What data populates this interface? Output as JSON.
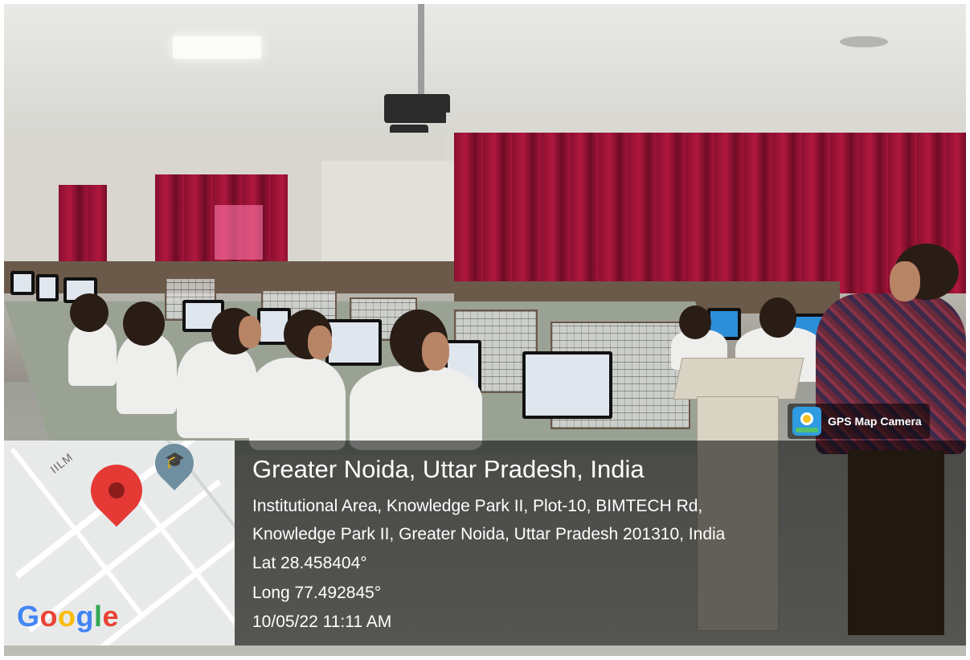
{
  "overlay": {
    "brand": {
      "label": "GPS Map Camera",
      "icon": "gps-map-camera-icon"
    },
    "location_title": "Greater Noida, Uttar Pradesh, India",
    "address_line1": "Institutional Area, Knowledge Park II, Plot-10, BIMTECH Rd,",
    "address_line2": "Knowledge Park II, Greater Noida, Uttar Pradesh 201310, India",
    "latitude": "Lat 28.458404°",
    "longitude": "Long 77.492845°",
    "datetime": "10/05/22 11:11 AM"
  },
  "map": {
    "road_label": "IILM",
    "logo": [
      "G",
      "o",
      "o",
      "g",
      "l",
      "e"
    ],
    "logo_colors": [
      "#4285F4",
      "#EA4335",
      "#FBBC05",
      "#4285F4",
      "#34A853",
      "#EA4335"
    ],
    "pin_color": "#E53935",
    "school_pin_color": "#6F8FA1"
  }
}
